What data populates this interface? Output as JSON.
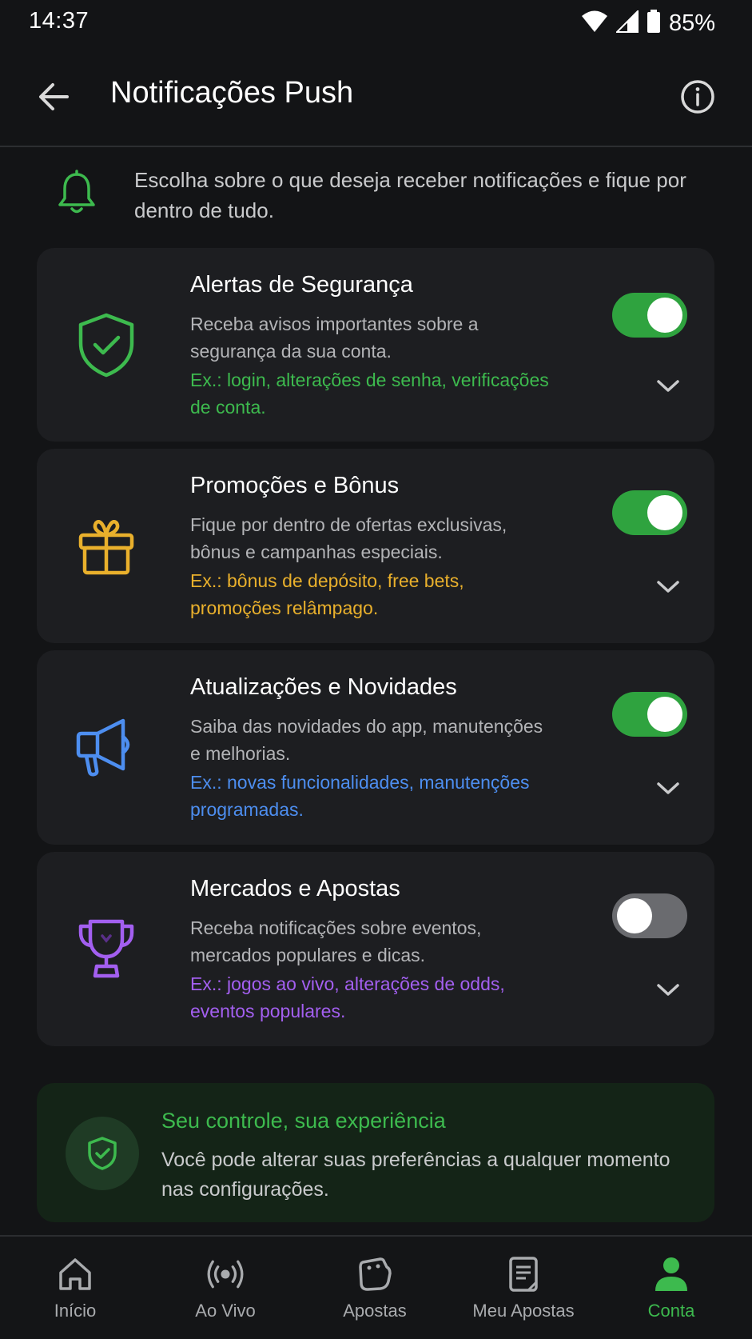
{
  "status_bar": {
    "time": "14:37",
    "battery": "85%",
    "icons": [
      "wifi-icon",
      "signal-icon",
      "battery-icon"
    ]
  },
  "header": {
    "title": "Notificações Push",
    "back_icon": "arrow-left-icon",
    "info_icon": "info-icon"
  },
  "intro": {
    "icon": "bell-icon",
    "text": "Escolha sobre o que deseja receber notificações e fique por dentro de tudo."
  },
  "cards": [
    {
      "title": "Alertas de Segurança",
      "description": "Receba avisos importantes sobre a segurança da sua conta.",
      "example": "Ex.: login, alterações de senha, verificações de conta.",
      "icon": "shield-check-icon",
      "accent": "#3dba4e",
      "enabled": true
    },
    {
      "title": "Promoções e Bônus",
      "description": "Fique por dentro de ofertas exclusivas, bônus e campanhas especiais.",
      "example": "Ex.: bônus de depósito, free bets, promoções relâmpago.",
      "icon": "gift-icon",
      "accent": "#e9b02c",
      "enabled": true
    },
    {
      "title": "Atualizações e Novidades",
      "description": "Saiba das novidades do app, manutenções e melhorias.",
      "example": "Ex.: novas funcionalidades, manutenções programadas.",
      "icon": "megaphone-icon",
      "accent": "#4d8ef0",
      "enabled": true
    },
    {
      "title": "Mercados e Apostas",
      "description": "Receba notificações sobre eventos, mercados populares e dicas.",
      "example": "Ex.: jogos ao vivo, alterações de odds, eventos populares.",
      "icon": "trophy-icon",
      "accent": "#a35ff0",
      "enabled": false
    }
  ],
  "control": {
    "icon": "shield-check-icon",
    "title": "Seu controle, sua experiência",
    "text": "Você pode alterar suas preferências a qualquer momento nas configurações."
  },
  "nav": [
    {
      "label": "Início",
      "icon": "home-icon",
      "active": false
    },
    {
      "label": "Ao Vivo",
      "icon": "live-broadcast-icon",
      "active": false
    },
    {
      "label": "Apostas",
      "icon": "ticket-icon",
      "active": false
    },
    {
      "label": "Meu Apostas",
      "icon": "receipt-icon",
      "active": false
    },
    {
      "label": "Conta",
      "icon": "user-icon",
      "active": true
    }
  ],
  "colors": {
    "background": "#131416",
    "card": "#1d1e21",
    "toggle_on": "#2fa33f",
    "toggle_off": "#6a6b6f",
    "active_green": "#3dba4e"
  }
}
